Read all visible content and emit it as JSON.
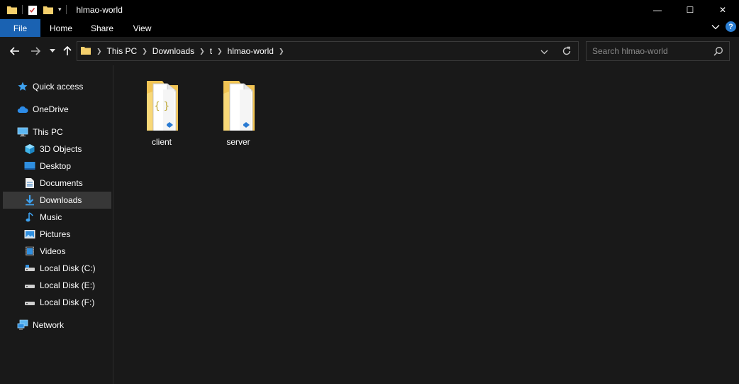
{
  "window": {
    "title": "hlmao-world",
    "minimize_glyph": "—",
    "maximize_glyph": "☐",
    "close_glyph": "✕"
  },
  "ribbon": {
    "tabs": [
      "File",
      "Home",
      "Share",
      "View"
    ],
    "help_glyph": "?"
  },
  "address": {
    "breadcrumbs": [
      "This PC",
      "Downloads",
      "t",
      "hlmao-world"
    ]
  },
  "search": {
    "placeholder": "Search hlmao-world"
  },
  "navigation": {
    "items": [
      {
        "label": "Quick access",
        "icon": "star-icon"
      },
      {
        "label": "OneDrive",
        "icon": "cloud-icon"
      },
      {
        "label": "This PC",
        "icon": "computer-icon"
      },
      {
        "label": "3D Objects",
        "icon": "cube-icon"
      },
      {
        "label": "Desktop",
        "icon": "desktop-icon"
      },
      {
        "label": "Documents",
        "icon": "document-icon"
      },
      {
        "label": "Downloads",
        "icon": "download-icon",
        "selected": true
      },
      {
        "label": "Music",
        "icon": "music-icon"
      },
      {
        "label": "Pictures",
        "icon": "picture-icon"
      },
      {
        "label": "Videos",
        "icon": "video-icon"
      },
      {
        "label": "Local Disk (C:)",
        "icon": "disk-icon"
      },
      {
        "label": "Local Disk (E:)",
        "icon": "disk-icon"
      },
      {
        "label": "Local Disk (F:)",
        "icon": "disk-icon"
      },
      {
        "label": "Network",
        "icon": "network-icon"
      }
    ]
  },
  "files": [
    {
      "name": "client",
      "icon": "folder-icon"
    },
    {
      "name": "server",
      "icon": "folder-icon"
    }
  ],
  "colors": {
    "accent": "#1a62b2",
    "folder": "#f4cf6c",
    "selection": "#373737"
  }
}
